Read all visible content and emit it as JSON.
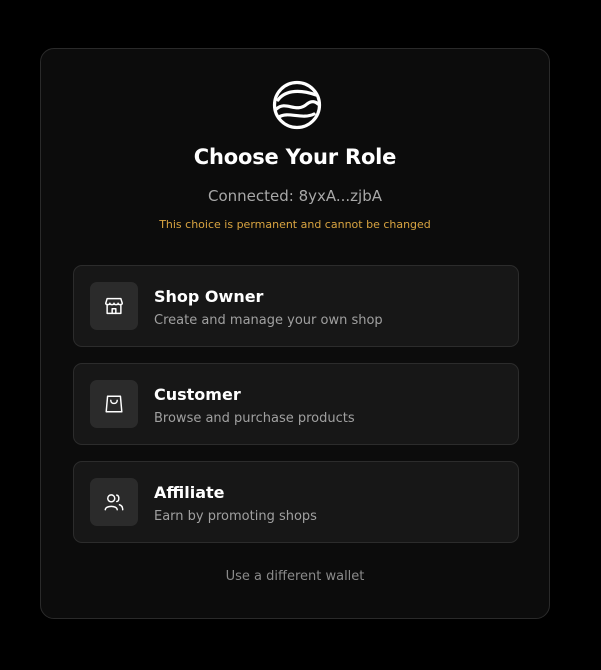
{
  "dialog": {
    "title": "Choose Your Role",
    "connected_text": "Connected: 8yxA...zjbA",
    "warning_text": "This choice is permanent and cannot be changed"
  },
  "roles": [
    {
      "title": "Shop Owner",
      "description": "Create and manage your own shop",
      "icon": "store-icon"
    },
    {
      "title": "Customer",
      "description": "Browse and purchase products",
      "icon": "shopping-bag-icon"
    },
    {
      "title": "Affiliate",
      "description": "Earn by promoting shops",
      "icon": "users-icon"
    }
  ],
  "footer": {
    "alt_wallet_label": "Use a different wallet"
  },
  "colors": {
    "background": "#000000",
    "card": "#0c0c0c",
    "role_card": "#171717",
    "warning": "#d9a441",
    "muted_text": "#a0a0a0"
  }
}
